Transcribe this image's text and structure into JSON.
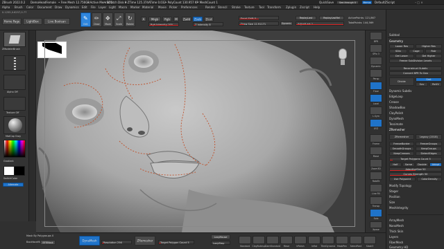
{
  "titlebar": {
    "app_title": "ZBrush 2022.0.2",
    "document": "DemoHeadFemale",
    "free_mem": "• Free Mesh 12.756GB",
    "active_mem": "• Active Mem 875",
    "scratch_disk": "• Scratch Disk 0",
    "ztime": "• ZTime 125.374",
    "atime": "ATime 0.032",
    "polycount": "• PolyCount 130.957 KP",
    "meshcount": "• MeshCount 1",
    "quicksave": "QuickSave",
    "seethrough": "See-through 0",
    "menus": "Menus",
    "default_zscript": "DefaultZScript"
  },
  "menubar": {
    "items": [
      "Alpha",
      "Brush",
      "Color",
      "Document",
      "Draw",
      "Dynamics",
      "Edit",
      "File",
      "Layer",
      "Light",
      "Macro",
      "Marker",
      "Material",
      "Movie",
      "Picker",
      "Preferences",
      "Render",
      "Stencil",
      "Stroke",
      "Texture",
      "Tool",
      "Transform",
      "Zplugin",
      "Zscript",
      "Help"
    ]
  },
  "topshelf": {
    "coords": "0.1255,0.6257,0.77",
    "home_page": "Home Page",
    "lightbox": "LightBox",
    "live_boolean": "Live Boolean",
    "edit": "Edit",
    "draw": "Draw",
    "move": "Move",
    "scale": "Scale",
    "rotate": "Rotate",
    "a_label": "A",
    "mrgb": "Mrgb",
    "rgb": "Rgb",
    "m": "M",
    "zadd": "Zadd",
    "zsub": "Zsub",
    "zcut": "Zcut",
    "rgb_intensity": "Rgb Intensity 100",
    "z_intensity": "Z Intensity 8",
    "focal_shift": "Focal Shift 0",
    "draw_size": "Draw Size 12.91171",
    "dynamic": "Dynamic",
    "replay_last": "ReplayLast",
    "replay_last_rel": "ReplayLastRel",
    "adjust_last": "AdjustLast 1",
    "active_points": "ActivePoints: 121,867",
    "total_points": "TotalPoints: 144,569",
    "tool_name": "DemoHeadFemale",
    "tool_sphere": "SimpleBrush"
  },
  "leftpanel": {
    "brush_label": "ZModelerBrush",
    "alpha_label": "Alpha Off",
    "texture_label": "Texture Off",
    "material_label": "MatCap Gray",
    "gradient": "Gradient",
    "switch_color": "SwitchColor",
    "alternate": "Alternate",
    "colors": {
      "main": "#ffffff",
      "secondary": "#000000"
    }
  },
  "rightshelf": {
    "buttons": [
      "BPR",
      "SPix 3",
      "Dynamic",
      "Persp",
      "Floor",
      "Local",
      "L.Sym",
      "XYZ",
      "",
      "",
      "Frame",
      "Move",
      "Zoom3D",
      "RotaTe",
      "Line Fill",
      "Transp",
      "Ghost",
      "Solo",
      "Xpose"
    ]
  },
  "rightpanel": {
    "subtool": "Subtool",
    "geometry": "Geometry",
    "lower_res": "Lower Res",
    "higher_res": "Higher Res",
    "sdiv": "SDiv",
    "cage": "Cage",
    "rstr": "Rstr",
    "del_lower": "Del Lower",
    "del_higher": "Del Higher",
    "freeze_subdiv": "Freeze SubDivision Levels",
    "reconstruct_subdiv": "Reconstruct Subdiv",
    "convert_bpr": "Convert BPR To Geo",
    "divide": "Divide",
    "smt": "Smt",
    "suv": "Suv",
    "rsuv": "ReUV",
    "dynamic_subdiv": "Dynamic Subdiv",
    "edge_loop": "EdgeLoop",
    "crease": "Crease",
    "shadowbox": "ShadowBox",
    "clay_polish": "ClayPolish",
    "dynamesh": "DynaMesh",
    "tessimate": "Tessimate",
    "zremesher_header": "ZRemesher",
    "zremesher_btn": "ZRemesher",
    "legacy": "Legacy (2018)",
    "freeze_border": "FreezeBorder",
    "freeze_groups": "FreezeGroups",
    "smooth_groups": "SmoothGroups",
    "keep_groups": "KeepGroups",
    "keep_creases": "KeepCreases",
    "detect_edges": "DetectEdges",
    "target_poly": "Target Polygons Count 5",
    "half": "Half",
    "same": "Same",
    "double": "Double",
    "adapt": "Adapt",
    "adaptive_size": "AdaptiveSize 50",
    "curves_strength": "Curves Strength 50",
    "use_polypaint": "Use Polypaint",
    "color_density": "ColorDensity",
    "modify_topology": "Modify Topology",
    "stager": "Stager",
    "position": "Position",
    "size": "Size",
    "mesh_integrity": "MeshIntegrity",
    "array_mesh": "ArrayMesh",
    "nano_mesh": "NanoMesh",
    "thick_skin": "Thick Skin",
    "layers": "Layers",
    "fiber_mesh": "FiberMesh",
    "geometry_hd": "Geometry HD"
  },
  "bottombar": {
    "mask_by_polygroups": "Mask By Polygroups 0",
    "backface_mask": "BackfaceMask",
    "bfr_mask": "BFRMask",
    "dynamesh": "DynaMesh",
    "resolution": "Resolution 256",
    "zremesher": "ZRemesher",
    "target_poly": "Target Polygon Count 5",
    "lazymouse": "LazyMouse",
    "lazystep": "LazyStep",
    "brushes": [
      "Standard",
      "ClayBuildup",
      "DamStandard",
      "Move",
      "hPolish",
      "Inflat",
      "TrimDynamic",
      "MaskPen",
      "SelectRect",
      "Slash3"
    ]
  },
  "colors": {
    "accent": "#1f73c9",
    "slider_red": "#dd2222",
    "panel": "#2f2f2f",
    "viewport": "#3e3e3e"
  }
}
